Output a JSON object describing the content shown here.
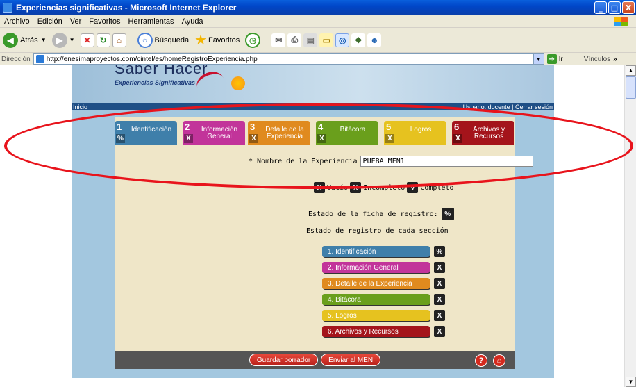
{
  "window": {
    "title": "Experiencias significativas - Microsoft Internet Explorer",
    "min": "_",
    "max": "□",
    "close": "X"
  },
  "menu": [
    "Archivo",
    "Edición",
    "Ver",
    "Favoritos",
    "Herramientas",
    "Ayuda"
  ],
  "toolbar": {
    "back": "Atrás",
    "search": "Búsqueda",
    "favorites": "Favoritos"
  },
  "address": {
    "label": "Dirección",
    "url": "http://enesimaproyectos.com/cintel/es/homeRegistroExperiencia.php",
    "go": "Ir",
    "links": "Vínculos"
  },
  "site": {
    "brand": "Saber Hacer",
    "subtitle": "Experiencias Significativas",
    "nav_home": "Inicio",
    "user_text": "Usuario: docente |",
    "logout": "Cerrar sesión"
  },
  "tabs": [
    {
      "num": "1",
      "label": "Identificación",
      "status": "%",
      "color": "#3f7faa"
    },
    {
      "num": "2",
      "label": "Información General",
      "status": "X",
      "color": "#c2349a"
    },
    {
      "num": "3",
      "label": "Detalle de la Experiencia",
      "status": "X",
      "color": "#e08a1e"
    },
    {
      "num": "4",
      "label": "Bitácora",
      "status": "X",
      "color": "#6a9f1c"
    },
    {
      "num": "5",
      "label": "Logros",
      "status": "X",
      "color": "#e6c21f"
    },
    {
      "num": "6",
      "label": "Archivos y Recursos",
      "status": "X",
      "color": "#a4141b"
    }
  ],
  "form": {
    "name_label": "* Nombre de la Experiencia",
    "name_value": "PUEBA MEN1"
  },
  "legend": [
    {
      "icon": "X",
      "label": "Vacío"
    },
    {
      "icon": "%",
      "label": "Incompleto"
    },
    {
      "icon": "V",
      "label": "Completo"
    }
  ],
  "estado_ficha": {
    "label": "Estado de la ficha de registro:",
    "status": "%"
  },
  "secciones_title": "Estado de registro de cada sección",
  "sections": [
    {
      "label": "1. Identificación",
      "status": "%",
      "color": "#3f7faa"
    },
    {
      "label": "2. Información General",
      "status": "X",
      "color": "#c2349a"
    },
    {
      "label": "3. Detalle de la Experiencia",
      "status": "X",
      "color": "#e08a1e"
    },
    {
      "label": "4. Bitácora",
      "status": "X",
      "color": "#6a9f1c"
    },
    {
      "label": "5. Logros",
      "status": "X",
      "color": "#e6c21f"
    },
    {
      "label": "6. Archivos y Recursos",
      "status": "X",
      "color": "#a4141b"
    }
  ],
  "footer": {
    "save": "Guardar borrador",
    "send": "Enviar al MEN",
    "help": "?",
    "home": "⌂"
  }
}
